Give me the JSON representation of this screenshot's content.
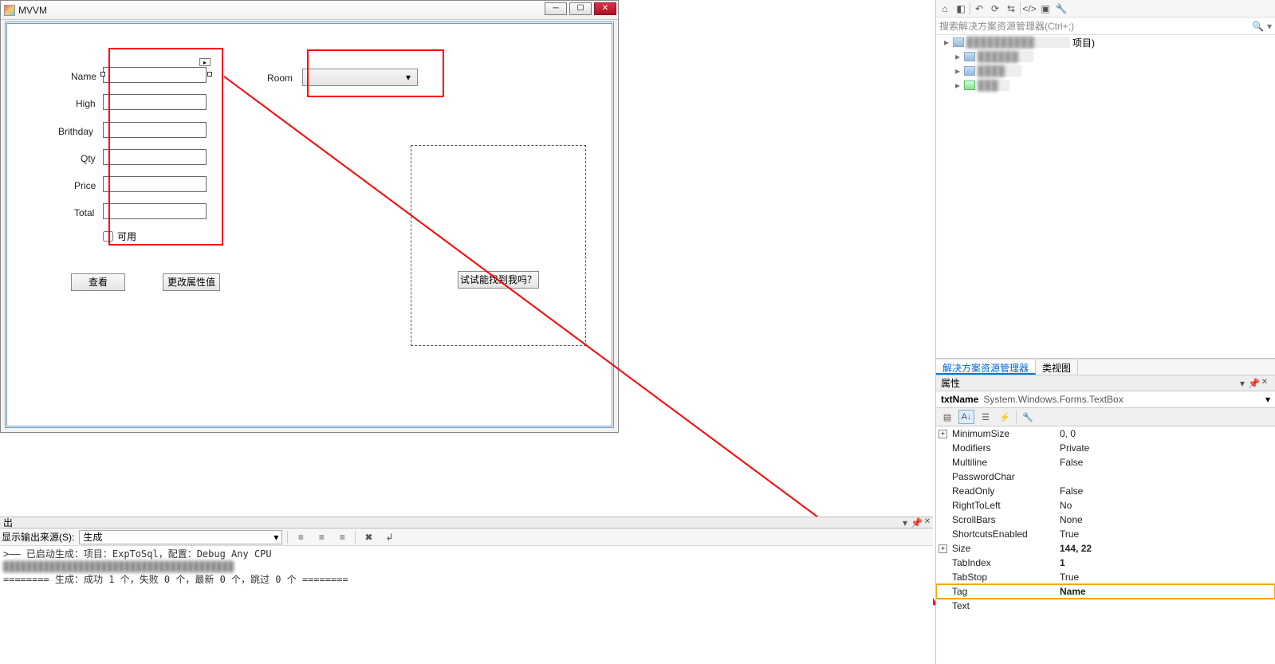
{
  "window": {
    "title": "MVVM"
  },
  "form": {
    "labels": {
      "name": "Name",
      "high": "High",
      "birthday": "Brithday",
      "qty": "Qty",
      "price": "Price",
      "total": "Total",
      "room": "Room"
    },
    "checkbox_label": "可用",
    "buttons": {
      "view": "查看",
      "change": "更改属性值",
      "find_me": "试试能找到我吗？"
    }
  },
  "output": {
    "panel_title": "出",
    "source_label": "显示输出来源(S):",
    "source_value": "生成",
    "lines": [
      ">—— 已启动生成：项目：ExpToSql，配置：Debug Any CPU",
      ">",
      "======== 生成：成功 1 个，失败 0 个，最新 0 个，跳过 0 个 ========"
    ]
  },
  "solution_explorer": {
    "search_placeholder": "搜索解决方案资源管理器(Ctrl+;)",
    "root_suffix": "项目)",
    "tabs": {
      "active": "解决方案资源管理器",
      "other": "类视图"
    }
  },
  "properties": {
    "panel_title": "属性",
    "object_name": "txtName",
    "object_type": "System.Windows.Forms.TextBox",
    "rows": [
      {
        "expand": true,
        "name": "MinimumSize",
        "value": "0, 0",
        "bold": false
      },
      {
        "expand": false,
        "name": "Modifiers",
        "value": "Private",
        "bold": false
      },
      {
        "expand": false,
        "name": "Multiline",
        "value": "False",
        "bold": false
      },
      {
        "expand": false,
        "name": "PasswordChar",
        "value": "",
        "bold": false
      },
      {
        "expand": false,
        "name": "ReadOnly",
        "value": "False",
        "bold": false
      },
      {
        "expand": false,
        "name": "RightToLeft",
        "value": "No",
        "bold": false
      },
      {
        "expand": false,
        "name": "ScrollBars",
        "value": "None",
        "bold": false
      },
      {
        "expand": false,
        "name": "ShortcutsEnabled",
        "value": "True",
        "bold": false
      },
      {
        "expand": true,
        "name": "Size",
        "value": "144, 22",
        "bold": true
      },
      {
        "expand": false,
        "name": "TabIndex",
        "value": "1",
        "bold": true
      },
      {
        "expand": false,
        "name": "TabStop",
        "value": "True",
        "bold": false
      },
      {
        "expand": false,
        "name": "Tag",
        "value": "Name",
        "bold": true,
        "hl": true
      },
      {
        "expand": false,
        "name": "Text",
        "value": "",
        "bold": false
      }
    ]
  }
}
